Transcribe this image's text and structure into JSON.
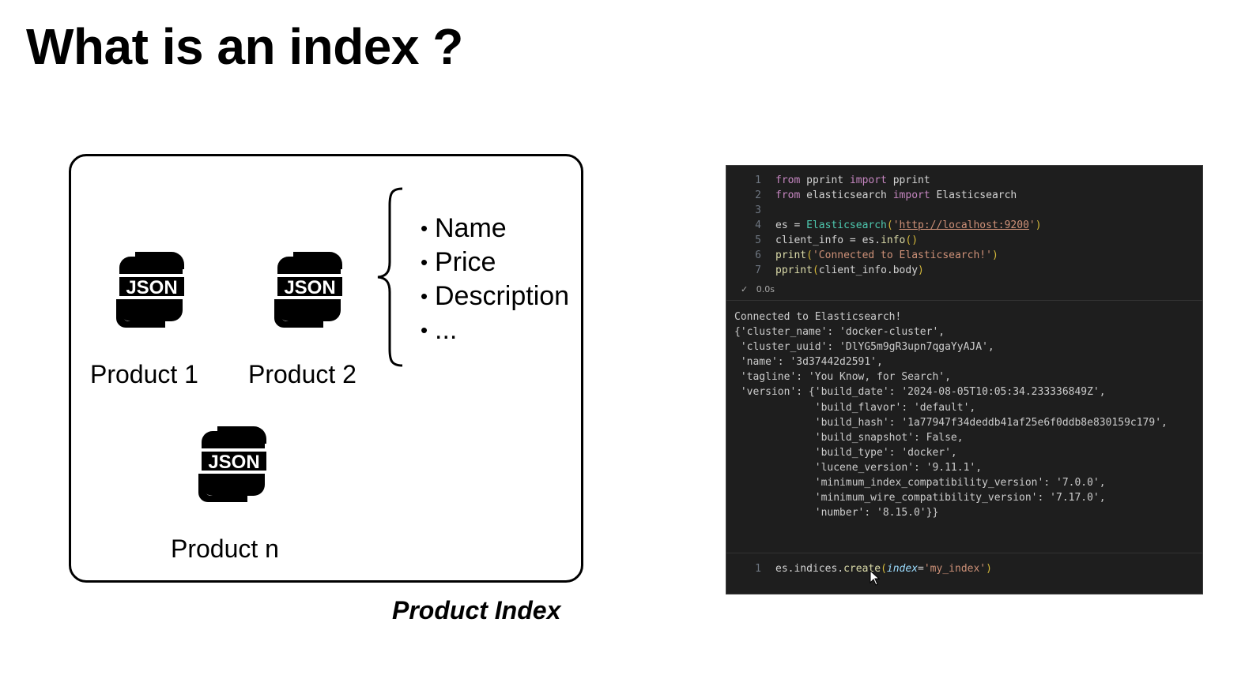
{
  "slide": {
    "title": "What is an index ?",
    "caption": "Product Index"
  },
  "products": [
    {
      "icon_text": "JSON",
      "label": "Product 1"
    },
    {
      "icon_text": "JSON",
      "label": "Product 2"
    },
    {
      "icon_text": "JSON",
      "label": "Product n"
    }
  ],
  "fields": [
    "Name",
    "Price",
    "Description",
    "..."
  ],
  "code": {
    "lines": [
      {
        "n": "1"
      },
      {
        "n": "2"
      },
      {
        "n": "3"
      },
      {
        "n": "4"
      },
      {
        "n": "5"
      },
      {
        "n": "6"
      },
      {
        "n": "7"
      }
    ],
    "tokens": {
      "from": "from",
      "import": "import",
      "pprint_mod": "pprint",
      "pprint_fn": "pprint",
      "elasticsearch_mod": "elasticsearch",
      "Elasticsearch": "Elasticsearch",
      "es_assign": "es = ",
      "url": "http://localhost:9200",
      "client_info_assign": "client_info = ",
      "es_info": "es.",
      "info": "info",
      "print": "print",
      "print_msg": "'Connected to Elasticsearch!'",
      "client_info_body": "client_info.body"
    },
    "status": "0.0s",
    "output": [
      "Connected to Elasticsearch!",
      "{'cluster_name': 'docker-cluster',",
      " 'cluster_uuid': 'DlYG5m9gR3upn7qgaYyAJA',",
      " 'name': '3d37442d2591',",
      " 'tagline': 'You Know, for Search',",
      " 'version': {'build_date': '2024-08-05T10:05:34.233336849Z',",
      "             'build_flavor': 'default',",
      "             'build_hash': '1a77947f34deddb41af25e6f0ddb8e830159c179',",
      "             'build_snapshot': False,",
      "             'build_type': 'docker',",
      "             'lucene_version': '9.11.1',",
      "             'minimum_index_compatibility_version': '7.0.0',",
      "             'minimum_wire_compatibility_version': '7.17.0',",
      "             'number': '8.15.0'}}"
    ],
    "cell2": {
      "n": "1",
      "es_indices": "es.indices.",
      "create": "create",
      "param": "index",
      "eq": "=",
      "value": "'my_index'"
    }
  },
  "colors": {
    "code_bg": "#1e1e1e",
    "keyword": "#c586c0",
    "function": "#dcdcaa",
    "class": "#4ec9b0",
    "string": "#ce9178"
  }
}
